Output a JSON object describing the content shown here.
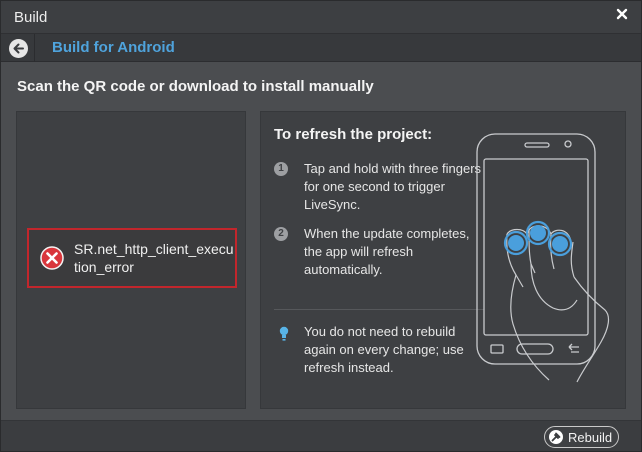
{
  "window": {
    "title": "Build"
  },
  "subheader": {
    "breadcrumb": "Build for Android"
  },
  "main": {
    "heading": "Scan the QR code or download to install manually"
  },
  "error": {
    "message": "SR.net_http_client_execution_error"
  },
  "instructions": {
    "title": "To refresh the project:",
    "steps": [
      {
        "number": "1",
        "text": "Tap and hold with three fingers for one second to trigger LiveSync."
      },
      {
        "number": "2",
        "text": "When the update completes, the app will refresh automatically."
      }
    ],
    "tip": "You do not need to rebuild again on every change; use refresh instead."
  },
  "footer": {
    "rebuild_label": "Rebuild"
  },
  "colors": {
    "accent": "#4fa3dc",
    "error": "#c2262c",
    "tip": "#58b4e8"
  },
  "icons": [
    "close-icon",
    "back-arrow-icon",
    "error-icon",
    "lightbulb-icon",
    "phone-gesture-illustration",
    "rebuild-icon"
  ]
}
